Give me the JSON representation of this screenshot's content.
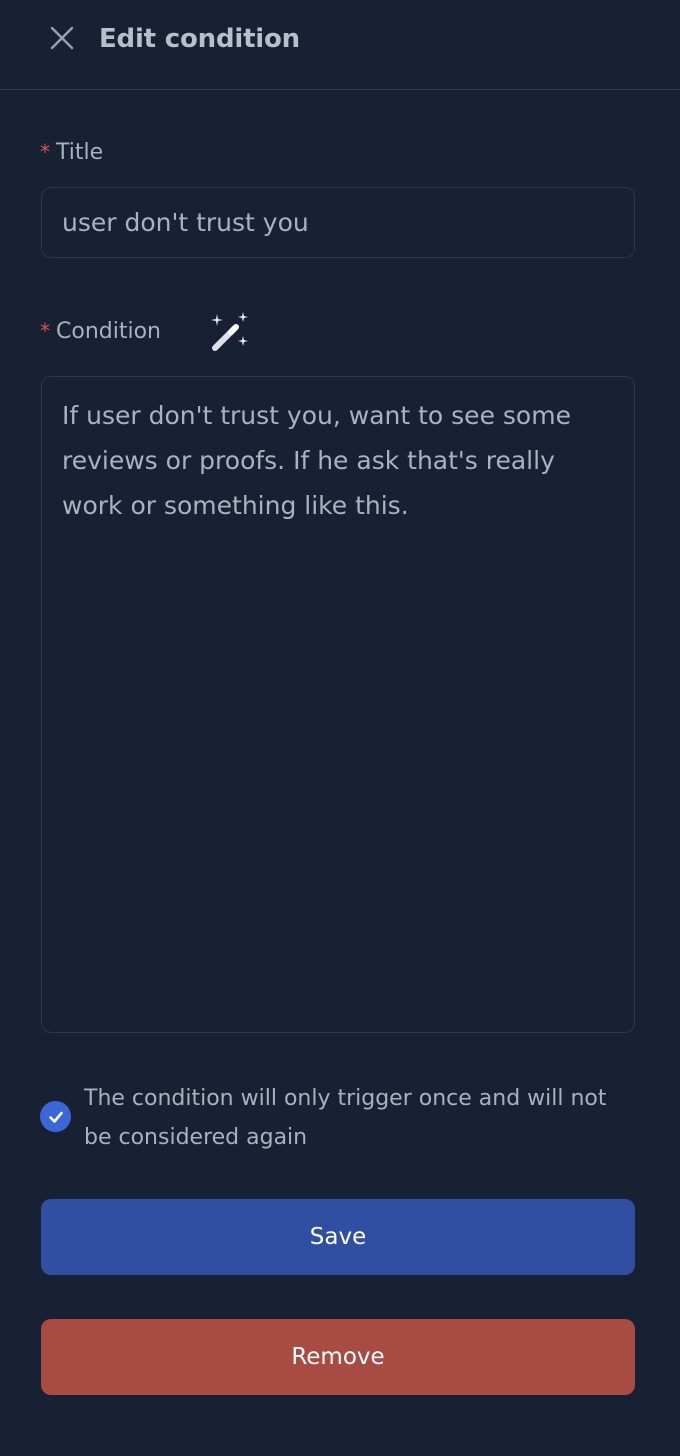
{
  "header": {
    "close_icon": "close-icon",
    "title": "Edit condition"
  },
  "form": {
    "required_marker": "*",
    "title_label": "Title",
    "title_value": "user don't trust you",
    "condition_label": "Condition",
    "magic_icon": "magic-wand-icon",
    "condition_value": "If user don't trust you, want to see some reviews or proofs. If he ask that's really work or something like this.",
    "trigger_once_checked": true,
    "trigger_once_text": "The condition will only trigger once and will not be considered again"
  },
  "actions": {
    "save_label": "Save",
    "remove_label": "Remove"
  },
  "colors": {
    "background": "#182033",
    "primary": "#304fa2",
    "danger": "#a84b43",
    "required": "#d8554b",
    "checkbox": "#3b67d6"
  }
}
